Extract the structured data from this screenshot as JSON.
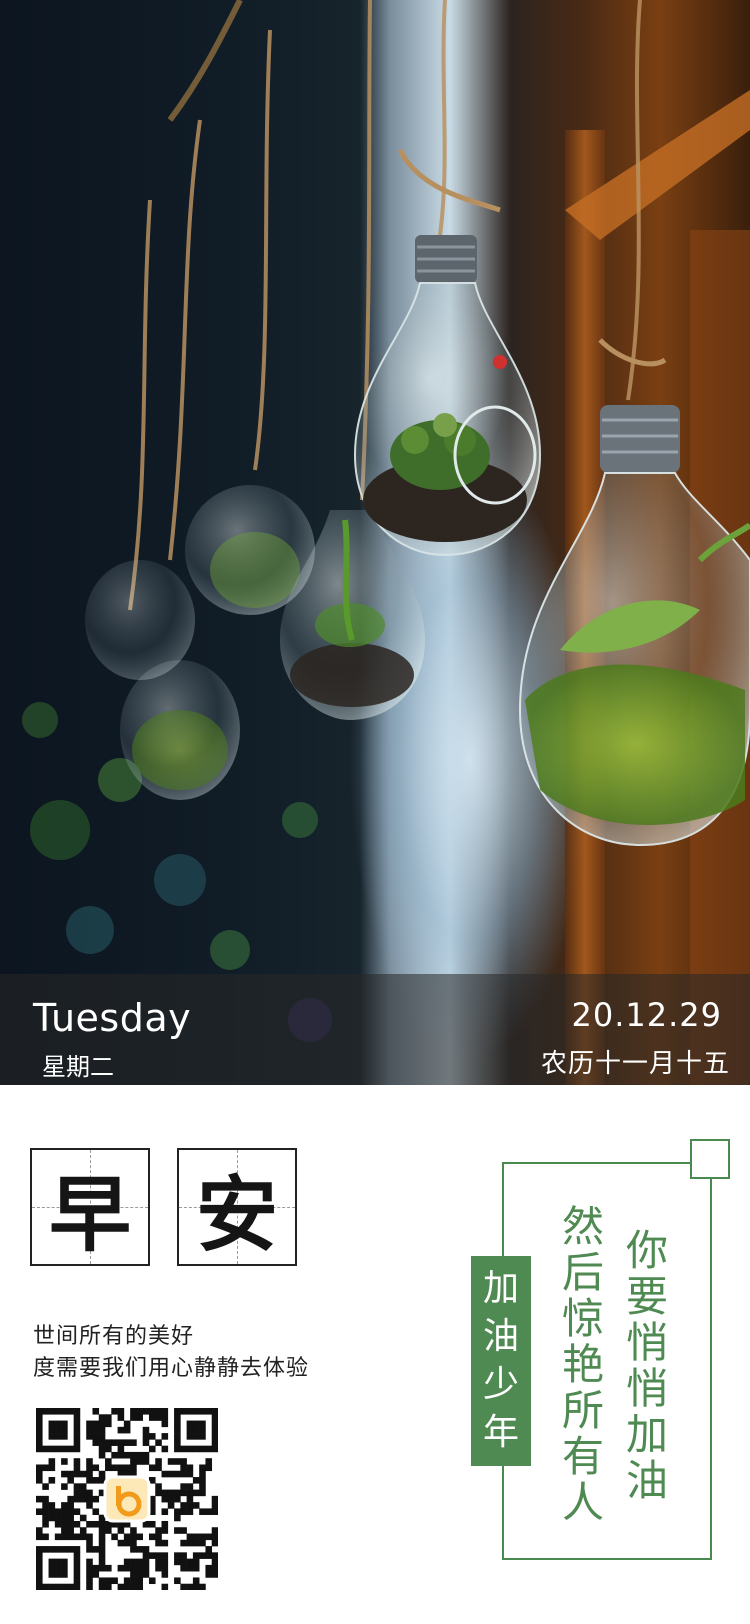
{
  "header": {
    "day_en": "Tuesday",
    "day_cn": "星期二",
    "date": "20.12.29",
    "lunar": "农历十一月十五"
  },
  "greeting": {
    "char1": "早",
    "char2": "安"
  },
  "quote": {
    "line1": "世间所有的美好",
    "line2": "度需要我们用心静静去体验"
  },
  "qr": {
    "logo_icon": "qr-logo-icon"
  },
  "tag": {
    "chars": [
      "加",
      "油",
      "少",
      "年"
    ]
  },
  "slogan": {
    "right_chars": [
      "你",
      "要",
      "悄",
      "悄",
      "加",
      "油"
    ],
    "left_chars": [
      "然",
      "后",
      "惊",
      "艳",
      "所",
      "有",
      "人"
    ]
  },
  "colors": {
    "accent": "#4f8a52",
    "band": "#282828"
  }
}
